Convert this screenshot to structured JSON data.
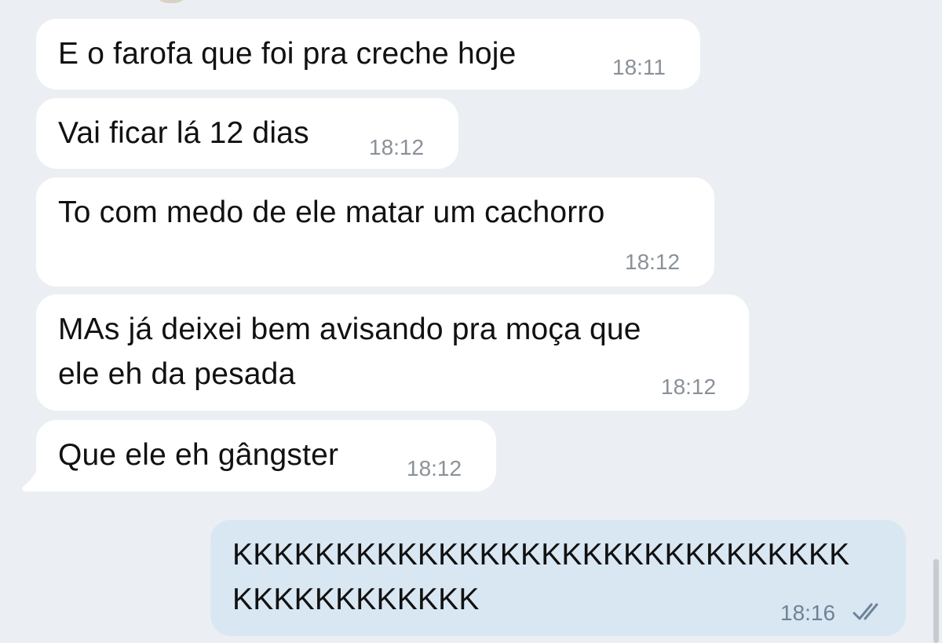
{
  "messages": [
    {
      "text": "E o farofa que foi pra creche hoje",
      "time": "18:11"
    },
    {
      "text": "Vai ficar lá 12 dias",
      "time": "18:12"
    },
    {
      "text": "To com medo de ele matar um cachorro",
      "time": "18:12"
    },
    {
      "text_lines": [
        "MAs já deixei bem avisando pra moça que",
        "ele eh da pesada"
      ],
      "time": "18:12"
    },
    {
      "text": "Que ele eh gângster",
      "time": "18:12"
    },
    {
      "text_lines": [
        "KKKKKKKKKKKKKKKKKKKKKKKKKKKKKK",
        "KKKKKKKKKKKK"
      ],
      "time": "18:16",
      "status_icon": "double-check-icon"
    }
  ],
  "colors": {
    "background": "#ebeff4",
    "incoming_bubble": "#ffffff",
    "outgoing_bubble": "#d9e7f3"
  }
}
